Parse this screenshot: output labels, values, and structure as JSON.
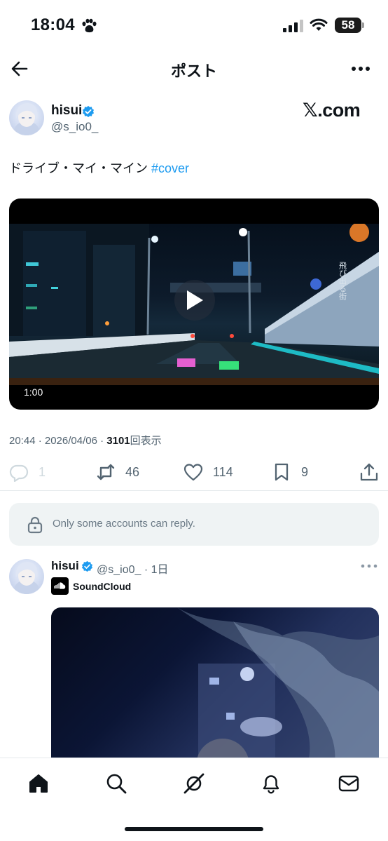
{
  "status_bar": {
    "time": "18:04",
    "battery": "58"
  },
  "header": {
    "title": "ポスト"
  },
  "post": {
    "author_name": "hisui",
    "author_handle": "@s_io0_",
    "source_logo": "𝕏.com",
    "text": "ドライブ・マイ・マイン",
    "hashtag": "#cover",
    "video": {
      "duration": "1:00",
      "caption_overlay": "飛び出る街"
    },
    "meta": {
      "timestamp": "20:44 · 2026/04/06 · ",
      "views": "3101",
      "views_label": "回表示"
    },
    "stats": {
      "replies": "1",
      "reposts": "46",
      "likes": "114",
      "bookmarks": "9"
    }
  },
  "reply_restriction": {
    "text": "Only some accounts can reply."
  },
  "reply_post": {
    "author_name": "hisui",
    "handle_time": "@s_io0_ · 1日",
    "card_label": "SoundCloud"
  },
  "colors": {
    "accent": "#1d9bf0",
    "text_primary": "#0f1419",
    "text_secondary": "#536471"
  },
  "icons": [
    "back-arrow-icon",
    "more-icon",
    "verified-icon",
    "play-icon",
    "reply-icon",
    "repost-icon",
    "like-icon",
    "bookmark-icon",
    "share-icon",
    "lock-icon",
    "soundcloud-icon",
    "home-icon",
    "search-icon",
    "grok-icon",
    "notifications-icon",
    "messages-icon"
  ]
}
